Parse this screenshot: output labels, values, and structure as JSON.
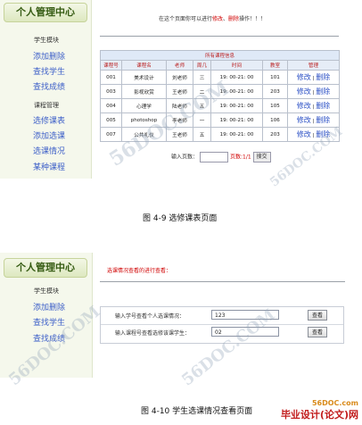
{
  "figure1": {
    "sidebar": {
      "title": "个人管理中心",
      "student_section": "学生模块",
      "student_links": [
        "添加删除",
        "查找学生",
        "查找成绩"
      ],
      "course_section": "课程管理",
      "course_links": [
        "选修课表",
        "添加选课",
        "选课情况",
        "某种课程"
      ]
    },
    "hint": {
      "prefix": "在这个页面你可以进行",
      "op1": "修改",
      "sep": "、",
      "op2": "删除",
      "suffix": "操作！！！"
    },
    "table": {
      "caption": "所有课程信息",
      "headers": [
        "课程号",
        "课程名",
        "老师",
        "周几",
        "时间",
        "教室",
        "管理"
      ],
      "rows": [
        [
          "001",
          "美术设计",
          "刘老师",
          "三",
          "19: 00-21: 00",
          "101"
        ],
        [
          "003",
          "影视欣赏",
          "王老师",
          "二",
          "19: 00-21: 00",
          "203"
        ],
        [
          "004",
          "心理学",
          "陆老师",
          "五",
          "19: 00-21: 00",
          "105"
        ],
        [
          "005",
          "photoshop",
          "李老师",
          "一",
          "19: 00-21: 00",
          "106"
        ],
        [
          "007",
          "公共礼仪",
          "王老师",
          "五",
          "19: 00-21: 00",
          "203"
        ]
      ],
      "edit_label": "修改",
      "delete_label": "删除"
    },
    "pager": {
      "label": "输入页数：",
      "total": "页数:1/1",
      "button": "搜交"
    },
    "caption": "图 4-9   选修课表页面"
  },
  "figure2": {
    "sidebar": {
      "title": "个人管理中心",
      "student_section": "学生模块",
      "student_links": [
        "添加删除",
        "查找学生",
        "查找成绩"
      ]
    },
    "hint": "选课情况查看的进行查看：",
    "rows": [
      {
        "label": "输入学号查看个人选课情况：",
        "value": "123",
        "button": "查看"
      },
      {
        "label": "输入课程号查看选修该课学生：",
        "value": "02",
        "button": "查看"
      }
    ],
    "caption": "图 4-10  学生选课情况查看页面"
  },
  "watermarks": [
    "56DOC.COM",
    "56DOC.COM",
    "56DOC.COM",
    "56DOC.COM"
  ],
  "brand": {
    "url": "56DOC.com",
    "name": "毕业设计(论文)网"
  }
}
